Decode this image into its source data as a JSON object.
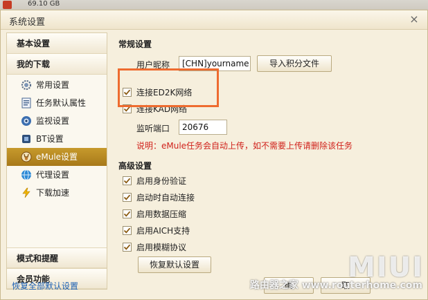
{
  "background_window": {
    "text": "69.10 GB"
  },
  "dialog": {
    "title": "系统设置",
    "close_label": "×"
  },
  "sidebar": {
    "sections": {
      "basic": "基本设置",
      "downloads": "我的下载",
      "mode": "模式和提醒",
      "member": "会员功能"
    },
    "items": [
      {
        "label": "常用设置",
        "icon": "gear-icon"
      },
      {
        "label": "任务默认属性",
        "icon": "task-list-icon"
      },
      {
        "label": "监视设置",
        "icon": "monitor-eye-icon"
      },
      {
        "label": "BT设置",
        "icon": "bt-icon"
      },
      {
        "label": "eMule设置",
        "icon": "emule-donkey-icon",
        "active": true
      },
      {
        "label": "代理设置",
        "icon": "globe-icon"
      },
      {
        "label": "下载加速",
        "icon": "lightning-icon"
      }
    ],
    "restore_all": "恢复全部默认设置"
  },
  "general": {
    "title": "常规设置",
    "nickname_label": "用户昵称",
    "nickname_value": "[CHN]yourname",
    "import_button": "导入积分文件",
    "ed2k_label": "连接ED2K网络",
    "ed2k_checked": true,
    "kad_label": "连接KAD网络",
    "kad_checked": true,
    "port_label": "监听端口",
    "port_value": "20676",
    "note": "说明：eMule任务会自动上传，如不需要上传请删除该任务"
  },
  "advanced": {
    "title": "高级设置",
    "options": [
      {
        "label": "启用身份验证",
        "checked": true
      },
      {
        "label": "启动时自动连接",
        "checked": true
      },
      {
        "label": "启用数据压缩",
        "checked": true
      },
      {
        "label": "启用AICH支持",
        "checked": true
      },
      {
        "label": "启用模糊协议",
        "checked": true
      }
    ],
    "restore_button": "恢复默认设置"
  },
  "footer": {
    "ok_label": "确",
    "cancel_label": "取"
  },
  "watermark": {
    "big": "MIUI",
    "small": "路由器之家 www.routerhome.com"
  },
  "colors": {
    "accent_active": "#b8871f",
    "highlight_border": "#ee6b2f",
    "note_red": "#d0211b",
    "link_blue": "#1a5fb4"
  }
}
